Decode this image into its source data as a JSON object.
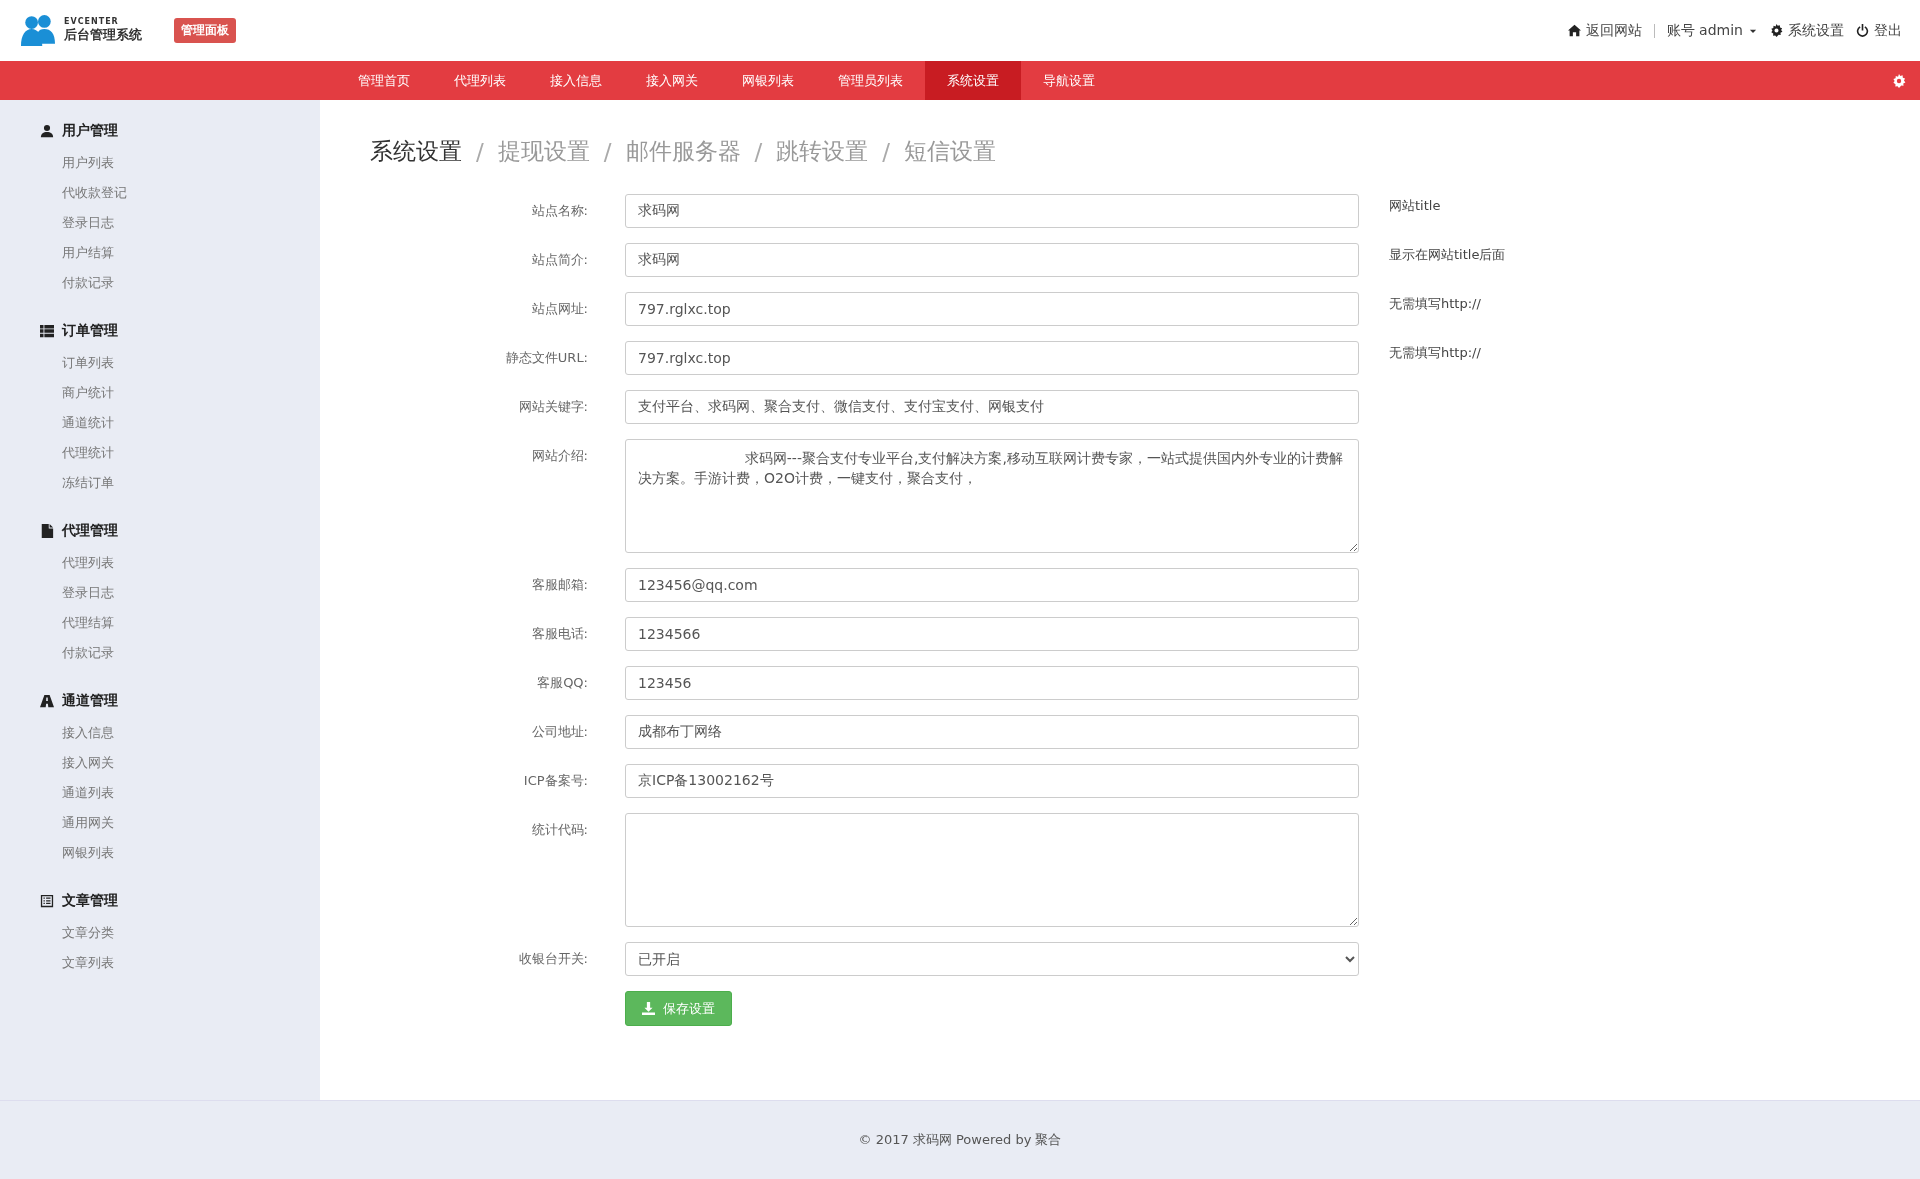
{
  "header": {
    "logo_caption": "EVCENTER",
    "logo_title": "后台管理系统",
    "badge": "管理面板",
    "links": [
      {
        "kind": "home",
        "label": "返回网站"
      },
      {
        "kind": "account",
        "label": "账号 admin"
      },
      {
        "kind": "settings",
        "label": "系统设置"
      },
      {
        "kind": "logout",
        "label": "登出"
      }
    ]
  },
  "nav": {
    "items": [
      {
        "label": "管理首页",
        "selected": false
      },
      {
        "label": "代理列表",
        "selected": false
      },
      {
        "label": "接入信息",
        "selected": false
      },
      {
        "label": "接入网关",
        "selected": false
      },
      {
        "label": "网银列表",
        "selected": false
      },
      {
        "label": "管理员列表",
        "selected": false
      },
      {
        "label": "系统设置",
        "selected": true
      },
      {
        "label": "导航设置",
        "selected": false
      }
    ]
  },
  "sidebar": {
    "groups": [
      {
        "kind": "user",
        "title": "用户管理",
        "items": [
          "用户列表",
          "代收款登记",
          "登录日志",
          "用户结算",
          "付款记录"
        ]
      },
      {
        "kind": "list",
        "title": "订单管理",
        "items": [
          "订单列表",
          "商户统计",
          "通道统计",
          "代理统计",
          "冻结订单"
        ]
      },
      {
        "kind": "file",
        "title": "代理管理",
        "items": [
          "代理列表",
          "登录日志",
          "代理结算",
          "付款记录"
        ]
      },
      {
        "kind": "road",
        "title": "通道管理",
        "items": [
          "接入信息",
          "接入网关",
          "通道列表",
          "通用网关",
          "网银列表"
        ]
      },
      {
        "kind": "doc",
        "title": "文章管理",
        "items": [
          "文章分类",
          "文章列表"
        ]
      }
    ]
  },
  "breadcrumb": [
    {
      "label": "系统设置",
      "selected": true
    },
    {
      "separator": "/",
      "label": "提现设置",
      "selected": false
    },
    {
      "separator": "/",
      "label": "邮件服务器",
      "selected": false
    },
    {
      "separator": "/",
      "label": "跳转设置",
      "selected": false
    },
    {
      "separator": "/",
      "label": "短信设置",
      "selected": false
    }
  ],
  "form": {
    "fields": [
      {
        "kind": "input",
        "label": "站点名称:",
        "value": "求码网",
        "hint": "网站title"
      },
      {
        "kind": "input",
        "label": "站点简介:",
        "value": "求码网",
        "hint": "显示在网站title后面"
      },
      {
        "kind": "input",
        "label": "站点网址:",
        "value": "797.rglxc.top",
        "hint": "无需填写http://"
      },
      {
        "kind": "input",
        "label": "静态文件URL:",
        "value": "797.rglxc.top",
        "hint": "无需填写http://"
      },
      {
        "kind": "input",
        "label": "网站关键字:",
        "value": "支付平台、求码网、聚合支付、微信支付、支付宝支付、网银支付"
      },
      {
        "kind": "textarea",
        "label": "网站介绍:",
        "value": "                        求码网---聚合支付专业平台,支付解决方案,移动互联网计费专家，一站式提供国内外专业的计费解决方案。手游计费，O2O计费，一键支付，聚合支付，"
      },
      {
        "kind": "input",
        "label": "客服邮箱:",
        "value": "123456@qq.com"
      },
      {
        "kind": "input",
        "label": "客服电话:",
        "value": "1234566"
      },
      {
        "kind": "input",
        "label": "客服QQ:",
        "value": "123456"
      },
      {
        "kind": "input",
        "label": "公司地址:",
        "value": "成都布丁网络"
      },
      {
        "kind": "input",
        "label": "ICP备案号:",
        "value": "京ICP备13002162号"
      },
      {
        "kind": "textarea",
        "label": "统计代码:"
      },
      {
        "kind": "select",
        "label": "收银台开关:",
        "value": "已开启"
      }
    ],
    "save_button": "保存设置"
  },
  "footer": "© 2017  求码网 Powered by 聚合"
}
